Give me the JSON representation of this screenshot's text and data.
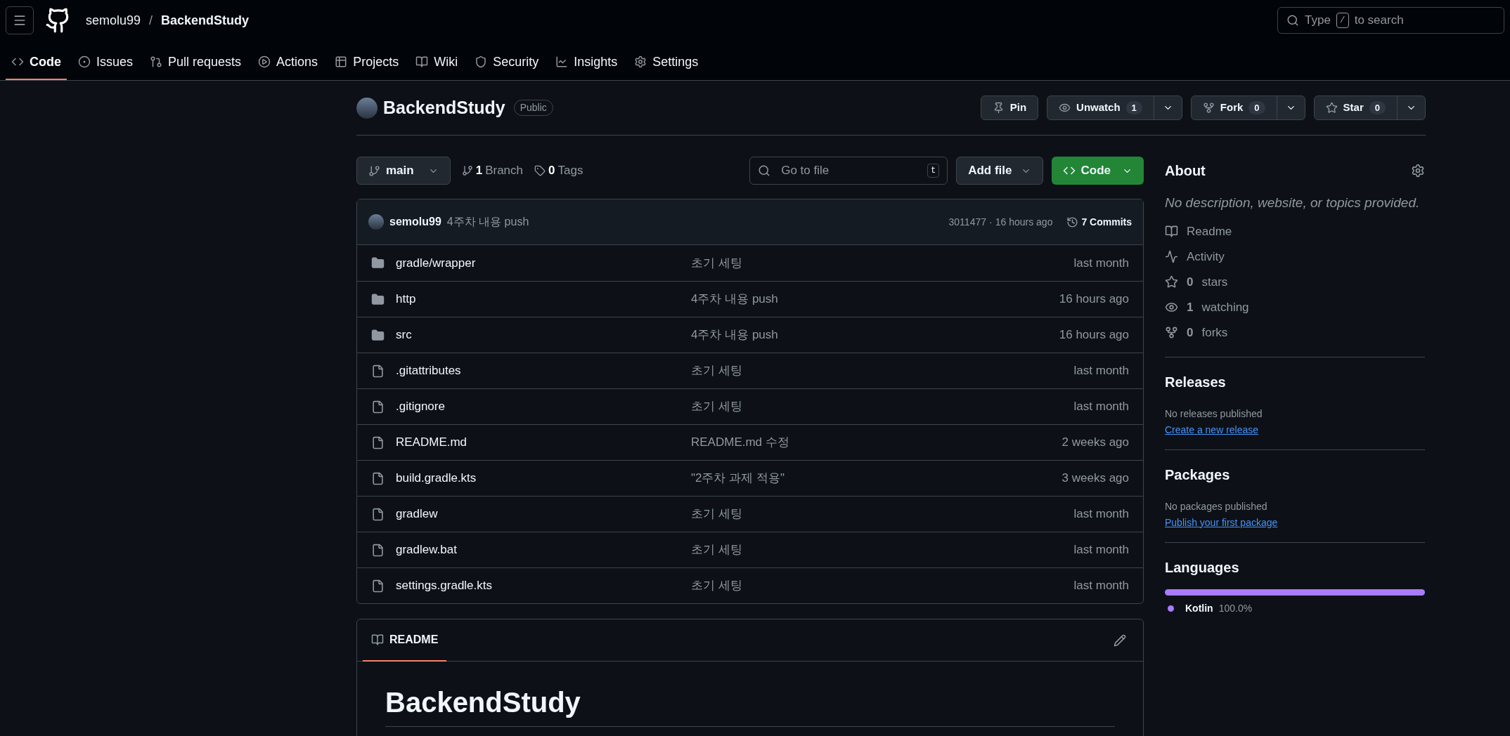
{
  "header": {
    "owner": "semolu99",
    "separator": "/",
    "repo": "BackendStudy",
    "search": {
      "before": "Type",
      "key": "/",
      "after": "to search"
    }
  },
  "nav_tabs": [
    {
      "label": "Code",
      "kind": "code",
      "selected": true
    },
    {
      "label": "Issues",
      "kind": "issues",
      "selected": false
    },
    {
      "label": "Pull requests",
      "kind": "pr",
      "selected": false
    },
    {
      "label": "Actions",
      "kind": "actions",
      "selected": false
    },
    {
      "label": "Projects",
      "kind": "projects",
      "selected": false
    },
    {
      "label": "Wiki",
      "kind": "wiki",
      "selected": false
    },
    {
      "label": "Security",
      "kind": "security",
      "selected": false
    },
    {
      "label": "Insights",
      "kind": "insights",
      "selected": false
    },
    {
      "label": "Settings",
      "kind": "settings",
      "selected": false
    }
  ],
  "repo": {
    "name": "BackendStudy",
    "visibility": "Public",
    "actions": [
      {
        "label": "Pin",
        "kind": "pin"
      },
      {
        "label": "Unwatch",
        "kind": "eye",
        "count": "1"
      },
      {
        "label": "Fork",
        "kind": "fork",
        "count": "0"
      },
      {
        "label": "Star",
        "kind": "star",
        "count": "0"
      }
    ]
  },
  "toolbar": {
    "branch": "main",
    "branches": {
      "count": "1",
      "label": "Branch"
    },
    "tags": {
      "count": "0",
      "label": "Tags"
    },
    "go_to_file": {
      "placeholder": "Go to file",
      "key": "t"
    },
    "add_file": "Add file",
    "code": "Code"
  },
  "latest_commit": {
    "author": "semolu99",
    "message": "4주차 내용 push",
    "hash": "3011477",
    "separator": "·",
    "time": "16 hours ago",
    "commits": "7 Commits"
  },
  "files": [
    {
      "kind": "dir",
      "name": "gradle/wrapper",
      "message": "초기 세팅",
      "time": "last month"
    },
    {
      "kind": "dir",
      "name": "http",
      "message": "4주차 내용 push",
      "time": "16 hours ago"
    },
    {
      "kind": "dir",
      "name": "src",
      "message": "4주차 내용 push",
      "time": "16 hours ago"
    },
    {
      "kind": "file",
      "name": ".gitattributes",
      "message": "초기 세팅",
      "time": "last month"
    },
    {
      "kind": "file",
      "name": ".gitignore",
      "message": "초기 세팅",
      "time": "last month"
    },
    {
      "kind": "file",
      "name": "README.md",
      "message": "README.md 수정",
      "time": "2 weeks ago"
    },
    {
      "kind": "file",
      "name": "build.gradle.kts",
      "message": "\"2주차 과제 적용\"",
      "time": "3 weeks ago"
    },
    {
      "kind": "file",
      "name": "gradlew",
      "message": "초기 세팅",
      "time": "last month"
    },
    {
      "kind": "file",
      "name": "gradlew.bat",
      "message": "초기 세팅",
      "time": "last month"
    },
    {
      "kind": "file",
      "name": "settings.gradle.kts",
      "message": "초기 세팅",
      "time": "last month"
    }
  ],
  "readme": {
    "tab": "README",
    "heading": "BackendStudy"
  },
  "about": {
    "title": "About",
    "description": "No description, website, or topics provided.",
    "items": [
      {
        "kind": "book",
        "label": "Readme"
      },
      {
        "kind": "pulse",
        "label": "Activity"
      },
      {
        "kind": "star",
        "count": "0",
        "label": "stars"
      },
      {
        "kind": "eye",
        "count": "1",
        "label": "watching"
      },
      {
        "kind": "fork",
        "count": "0",
        "label": "forks"
      }
    ]
  },
  "releases": {
    "title": "Releases",
    "text": "No releases published",
    "link": "Create a new release"
  },
  "packages": {
    "title": "Packages",
    "text": "No packages published",
    "link": "Publish your first package"
  },
  "languages": {
    "title": "Languages",
    "items": [
      {
        "name": "Kotlin",
        "percent": "100.0%",
        "color": "#a97bff",
        "level": 1
      }
    ]
  }
}
